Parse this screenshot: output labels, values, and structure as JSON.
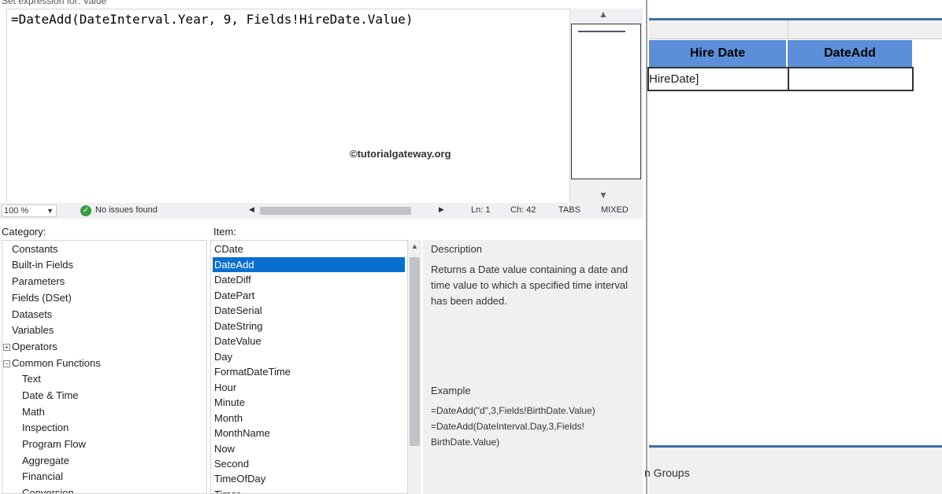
{
  "dialog": {
    "title": "Set expression for: Value",
    "expression": "=DateAdd(DateInterval.Year, 9, Fields!HireDate.Value)",
    "watermark": "©tutorialgateway.org"
  },
  "statusbar": {
    "zoom": "100 %",
    "issues": "No issues found",
    "line": "Ln: 1",
    "col": "Ch: 42",
    "tabs": "TABS",
    "mode": "MIXED"
  },
  "category": {
    "label": "Category:",
    "items": [
      "Constants",
      "Built-in Fields",
      "Parameters",
      "Fields (DSet)",
      "Datasets",
      "Variables",
      "Operators",
      "Common Functions"
    ],
    "sub_items": [
      "Text",
      "Date & Time",
      "Math",
      "Inspection",
      "Program Flow",
      "Aggregate",
      "Financial",
      "Conversion"
    ]
  },
  "item": {
    "label": "Item:",
    "items": [
      "CDate",
      "DateAdd",
      "DateDiff",
      "DatePart",
      "DateSerial",
      "DateString",
      "DateValue",
      "Day",
      "FormatDateTime",
      "Hour",
      "Minute",
      "Month",
      "MonthName",
      "Now",
      "Second",
      "TimeOfDay",
      "Timer"
    ],
    "selected": "DateAdd"
  },
  "description": {
    "heading": "Description",
    "text": "Returns a Date value containing a date and time value to which a specified time interval has been added.",
    "example_heading": "Example",
    "example_line1": "=DateAdd(\"d\",3,Fields!BirthDate.Value)",
    "example_line2": "=DateAdd(DateInterval.Day,3,Fields!",
    "example_line3": "BirthDate.Value)"
  },
  "designer": {
    "col_hire": "Hire Date",
    "col_dateadd": "DateAdd",
    "cell_hire": "HireDate]",
    "cell_dateadd": "",
    "groups_label": "n Groups"
  },
  "icons": {
    "issues": "check-circle-icon",
    "scroll_up": "triangle-up-icon",
    "scroll_down": "triangle-down-icon"
  }
}
